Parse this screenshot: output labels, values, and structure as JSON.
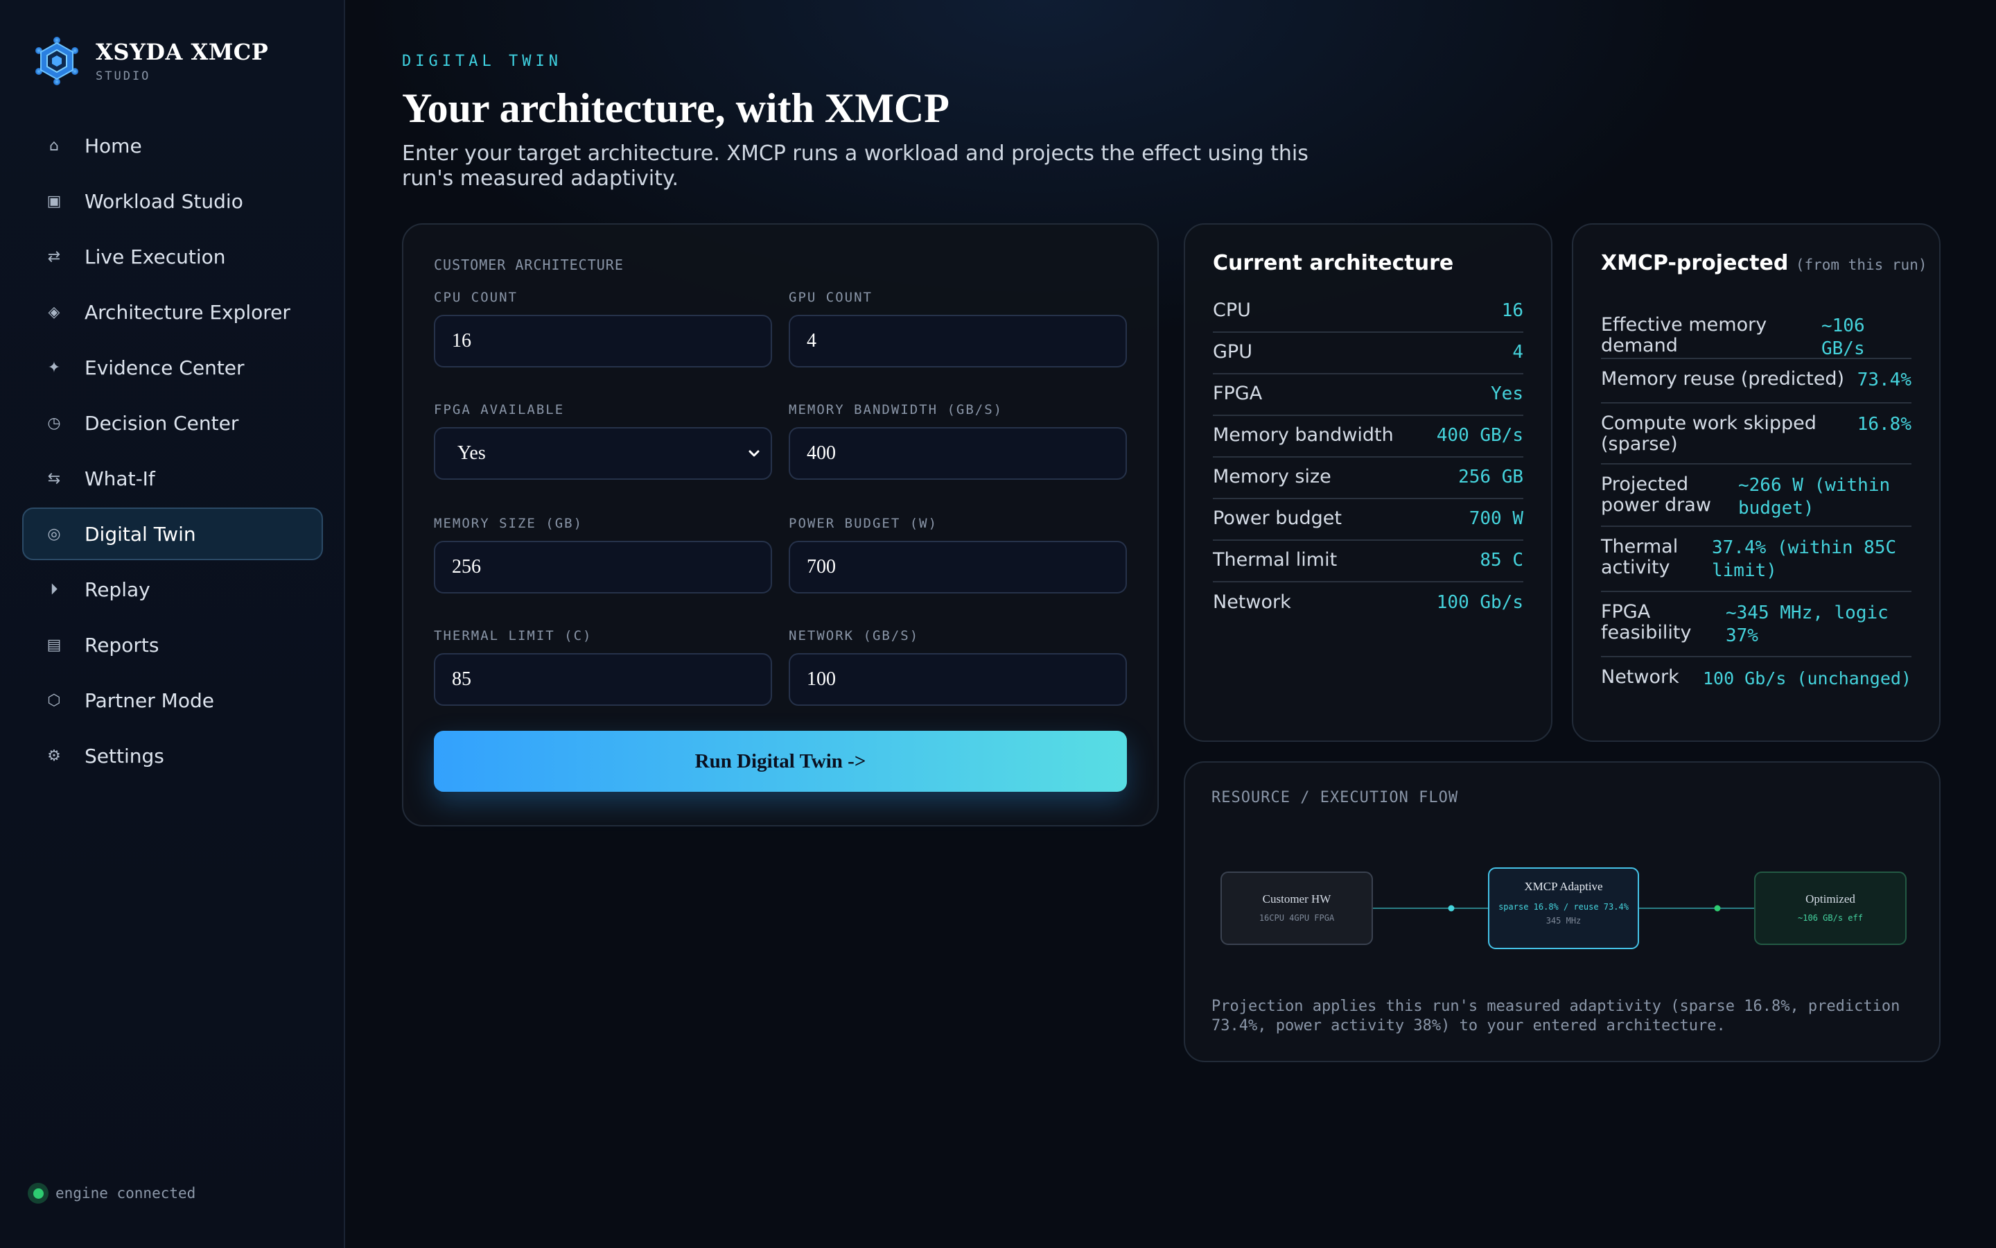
{
  "brand": {
    "name": "XSYDA XMCP",
    "sub": "STUDIO",
    "logo_icon": "hexagon-gear-logo"
  },
  "sidebar": {
    "items": [
      {
        "label": "Home",
        "icon": "⌂",
        "active": false
      },
      {
        "label": "Workload Studio",
        "icon": "▣",
        "active": false
      },
      {
        "label": "Live Execution",
        "icon": "⇄",
        "active": false
      },
      {
        "label": "Architecture Explorer",
        "icon": "◈",
        "active": false
      },
      {
        "label": "Evidence Center",
        "icon": "✦",
        "active": false
      },
      {
        "label": "Decision Center",
        "icon": "◷",
        "active": false
      },
      {
        "label": "What-If",
        "icon": "⇆",
        "active": false
      },
      {
        "label": "Digital Twin",
        "icon": "◎",
        "active": true
      },
      {
        "label": "Replay",
        "icon": "⏵",
        "active": false
      },
      {
        "label": "Reports",
        "icon": "▤",
        "active": false
      },
      {
        "label": "Partner Mode",
        "icon": "⬡",
        "active": false
      },
      {
        "label": "Settings",
        "icon": "⚙",
        "active": false
      }
    ],
    "engine_status": "engine connected"
  },
  "page": {
    "eyebrow": "DIGITAL TWIN",
    "title": "Your architecture, with XMCP",
    "description": "Enter your target architecture. XMCP runs a workload and projects the effect using this run's measured adaptivity."
  },
  "form": {
    "section_label": "CUSTOMER ARCHITECTURE",
    "cpu_label": "CPU COUNT",
    "cpu_value": "16",
    "gpu_label": "GPU COUNT",
    "gpu_value": "4",
    "fpga_label": "FPGA AVAILABLE",
    "fpga_value": "Yes",
    "membw_label": "MEMORY BANDWIDTH (GB/S)",
    "membw_value": "400",
    "memsize_label": "MEMORY SIZE (GB)",
    "memsize_value": "256",
    "power_label": "POWER BUDGET (W)",
    "power_value": "700",
    "thermal_label": "THERMAL LIMIT (C)",
    "thermal_value": "85",
    "network_label": "NETWORK (GB/S)",
    "network_value": "100",
    "run_label": "Run Digital Twin ->"
  },
  "current": {
    "title": "Current architecture",
    "rows": [
      {
        "k": "CPU",
        "v": "16"
      },
      {
        "k": "GPU",
        "v": "4"
      },
      {
        "k": "FPGA",
        "v": "Yes"
      },
      {
        "k": "Memory bandwidth",
        "v": "400 GB/s"
      },
      {
        "k": "Memory size",
        "v": "256 GB"
      },
      {
        "k": "Power budget",
        "v": "700 W"
      },
      {
        "k": "Thermal limit",
        "v": "85 C"
      },
      {
        "k": "Network",
        "v": "100 Gb/s"
      }
    ]
  },
  "projected": {
    "title": "XMCP-projected",
    "title_note": "(from this run)",
    "rows": [
      {
        "k": "Effective memory demand",
        "v": "~106 GB/s"
      },
      {
        "k": "Memory reuse (predicted)",
        "v": "73.4%"
      },
      {
        "k": "Compute work skipped (sparse)",
        "v": "16.8%"
      },
      {
        "k": "Projected power draw",
        "v": "~266 W (within budget)"
      },
      {
        "k": "Thermal activity",
        "v": "37.4% (within 85C limit)"
      },
      {
        "k": "FPGA feasibility",
        "v": "~345 MHz, logic 37%"
      },
      {
        "k": "Network",
        "v": "100 Gb/s (unchanged)"
      }
    ]
  },
  "flow": {
    "title": "RESOURCE / EXECUTION FLOW",
    "nodes": [
      {
        "title": "Customer HW",
        "sub1": "16CPU 4GPU FPGA",
        "sub2": ""
      },
      {
        "title": "XMCP Adaptive",
        "sub1": "sparse 16.8% / reuse 73.4%",
        "sub2": "345 MHz"
      },
      {
        "title": "Optimized",
        "sub1": "~106 GB/s eff",
        "sub2": ""
      }
    ],
    "note": "Projection applies this run's measured adaptivity (sparse 16.8%, prediction 73.4%, power activity 38%) to your entered architecture."
  },
  "colors": {
    "accent": "#45d3dc",
    "button_start": "#33a1fd",
    "button_end": "#58dde3",
    "status_green": "#2ecc71"
  }
}
